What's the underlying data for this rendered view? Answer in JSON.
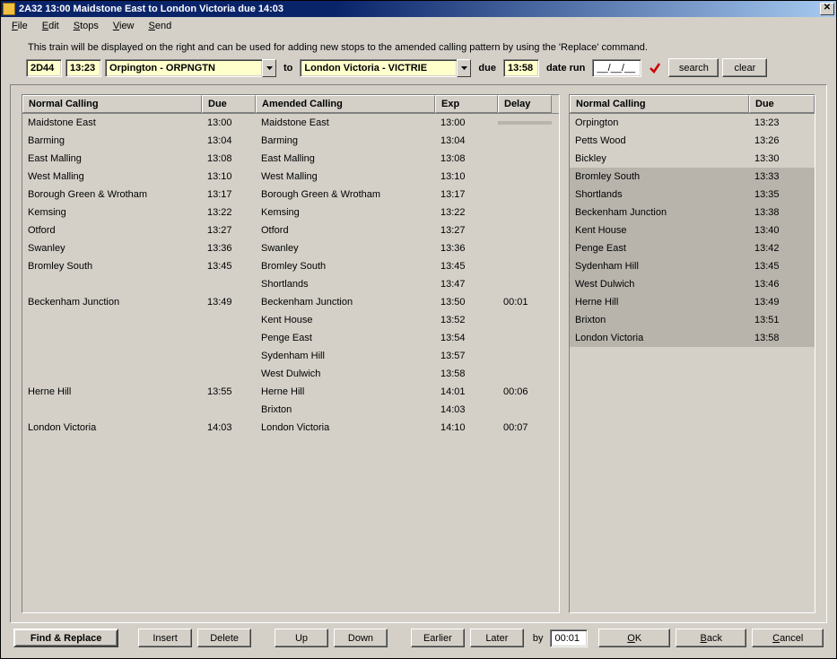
{
  "window": {
    "title": "2A32 13:00 Maidstone East to London Victoria due 14:03"
  },
  "menu": {
    "file": "File",
    "edit": "Edit",
    "stops": "Stops",
    "view": "View",
    "send": "Send"
  },
  "info_text": "This train will be displayed on the right and can be used for adding new stops to the amended calling pattern by using the 'Replace' command.",
  "toolbar": {
    "headcode": "2D44",
    "time": "13:23",
    "origin": "Orpington - ORPNGTN",
    "to_label": "to",
    "dest": "London Victoria - VICTRIE",
    "due_label": "due",
    "due_time": "13:58",
    "date_run_label": "date run",
    "date_run": "__/__/__",
    "search_label": "search",
    "clear_label": "clear"
  },
  "left_headers": {
    "normal": "Normal Calling",
    "due": "Due",
    "amended": "Amended Calling",
    "exp": "Exp",
    "delay": "Delay"
  },
  "right_headers": {
    "normal": "Normal Calling",
    "due": "Due"
  },
  "rows": [
    {
      "n": "Maidstone East",
      "nd": "13:00",
      "a": "Maidstone East",
      "e": "13:00",
      "d": "",
      "sel": true
    },
    {
      "n": "Barming",
      "nd": "13:04",
      "a": "Barming",
      "e": "13:04",
      "d": ""
    },
    {
      "n": "East Malling",
      "nd": "13:08",
      "a": "East Malling",
      "e": "13:08",
      "d": ""
    },
    {
      "n": "West Malling",
      "nd": "13:10",
      "a": "West Malling",
      "e": "13:10",
      "d": ""
    },
    {
      "n": "Borough Green & Wrotham",
      "nd": "13:17",
      "a": "Borough Green & Wrotham",
      "e": "13:17",
      "d": ""
    },
    {
      "n": "Kemsing",
      "nd": "13:22",
      "a": "Kemsing",
      "e": "13:22",
      "d": ""
    },
    {
      "n": "Otford",
      "nd": "13:27",
      "a": "Otford",
      "e": "13:27",
      "d": ""
    },
    {
      "n": "Swanley",
      "nd": "13:36",
      "a": "Swanley",
      "e": "13:36",
      "d": ""
    },
    {
      "n": "Bromley South",
      "nd": "13:45",
      "a": "Bromley South",
      "e": "13:45",
      "d": ""
    },
    {
      "n": "",
      "nd": "",
      "a": "Shortlands",
      "e": "13:47",
      "d": ""
    },
    {
      "n": "Beckenham Junction",
      "nd": "13:49",
      "a": "Beckenham Junction",
      "e": "13:50",
      "d": "00:01"
    },
    {
      "n": "",
      "nd": "",
      "a": "Kent House",
      "e": "13:52",
      "d": ""
    },
    {
      "n": "",
      "nd": "",
      "a": "Penge East",
      "e": "13:54",
      "d": ""
    },
    {
      "n": "",
      "nd": "",
      "a": "Sydenham Hill",
      "e": "13:57",
      "d": ""
    },
    {
      "n": "",
      "nd": "",
      "a": "West Dulwich",
      "e": "13:58",
      "d": ""
    },
    {
      "n": "Herne Hill",
      "nd": "13:55",
      "a": "Herne Hill",
      "e": "14:01",
      "d": "00:06"
    },
    {
      "n": "",
      "nd": "",
      "a": "Brixton",
      "e": "14:03",
      "d": ""
    },
    {
      "n": "London Victoria",
      "nd": "14:03",
      "a": "London Victoria",
      "e": "14:10",
      "d": "00:07"
    }
  ],
  "right_rows": [
    {
      "n": "Orpington",
      "d": "13:23",
      "sel": false
    },
    {
      "n": "Petts Wood",
      "d": "13:26",
      "sel": false
    },
    {
      "n": "Bickley",
      "d": "13:30",
      "sel": false
    },
    {
      "n": "Bromley South",
      "d": "13:33",
      "sel": true
    },
    {
      "n": "Shortlands",
      "d": "13:35",
      "sel": true
    },
    {
      "n": "Beckenham Junction",
      "d": "13:38",
      "sel": true
    },
    {
      "n": "Kent House",
      "d": "13:40",
      "sel": true
    },
    {
      "n": "Penge East",
      "d": "13:42",
      "sel": true
    },
    {
      "n": "Sydenham Hill",
      "d": "13:45",
      "sel": true
    },
    {
      "n": "West Dulwich",
      "d": "13:46",
      "sel": true
    },
    {
      "n": "Herne Hill",
      "d": "13:49",
      "sel": true
    },
    {
      "n": "Brixton",
      "d": "13:51",
      "sel": true
    },
    {
      "n": "London Victoria",
      "d": "13:58",
      "sel": true
    }
  ],
  "footer": {
    "find_replace": "Find & Replace",
    "insert": "Insert",
    "delete": "Delete",
    "up": "Up",
    "down": "Down",
    "earlier": "Earlier",
    "later": "Later",
    "by_label": "by",
    "by_value": "00:01",
    "ok": "OK",
    "back": "Back",
    "cancel": "Cancel"
  }
}
